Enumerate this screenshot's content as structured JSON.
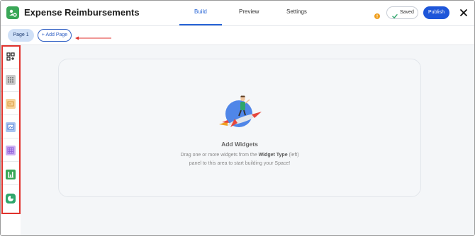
{
  "header": {
    "title": "Expense Reimbursements",
    "tabs": [
      "Build",
      "Preview",
      "Settings"
    ],
    "active_tab": "Build",
    "saved_label": "Saved",
    "publish_label": "Publish",
    "brand_color": "#2563d6",
    "logo_color": "#3aa757"
  },
  "pagebar": {
    "pages": [
      "Page 1"
    ],
    "add_page_label": "+ Add Page"
  },
  "sidebar": {
    "items": [
      {
        "icon": "grid-add-icon",
        "color": "#222222"
      },
      {
        "icon": "table-grid-icon",
        "color": "#bdbdbd"
      },
      {
        "icon": "card-icon",
        "color": "#f4c37a"
      },
      {
        "icon": "image-icon",
        "color": "#7ea7ea"
      },
      {
        "icon": "calendar-grid-icon",
        "color": "#b88bea"
      },
      {
        "icon": "chart-icon",
        "color": "#3aa757"
      },
      {
        "icon": "pie-chart-icon",
        "color": "#2ea66b"
      }
    ]
  },
  "canvas": {
    "empty_title": "Add Widgets",
    "empty_desc_prefix": "Drag one or more widgets from the ",
    "empty_desc_bold": "Widget Type",
    "empty_desc_suffix": " (left)",
    "empty_desc_line2": "panel to this area to start building your Space!"
  }
}
